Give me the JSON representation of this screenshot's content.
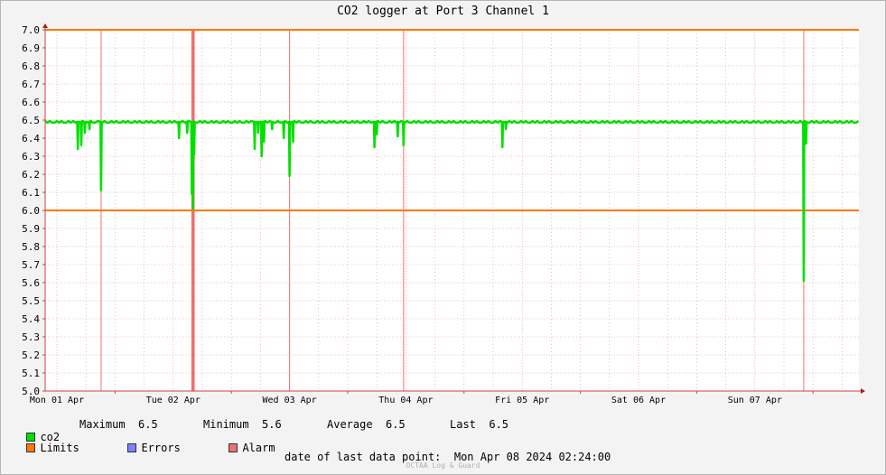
{
  "title": "CO2 logger at Port 3 Channel 1",
  "chart_data": {
    "type": "line",
    "title": "CO2 logger at Port 3 Channel 1",
    "ylim": [
      5.0,
      7.0
    ],
    "y_ticks": [
      "5.0",
      "5.1",
      "5.2",
      "5.3",
      "5.4",
      "5.5",
      "5.6",
      "5.7",
      "5.8",
      "5.9",
      "6.0",
      "6.1",
      "6.2",
      "6.3",
      "6.4",
      "6.5",
      "6.6",
      "6.7",
      "6.8",
      "6.9",
      "7.0"
    ],
    "x_ticks": [
      "Mon 01 Apr",
      "Tue 02 Apr",
      "Wed 03 Apr",
      "Thu 04 Apr",
      "Fri 05 Apr",
      "Sat 06 Apr",
      "Sun 07 Apr"
    ],
    "limits": [
      6.0,
      7.0
    ],
    "grid": true,
    "colors": {
      "co2": "#00e000",
      "limits": "#ff7700",
      "errors": "#7f7fff",
      "alarm": "#f07070",
      "grid": "#e09090"
    },
    "series": [
      {
        "name": "co2",
        "baseline": 6.49,
        "dips_day_value": [
          [
            0.18,
            6.34
          ],
          [
            0.21,
            6.36
          ],
          [
            0.24,
            6.43
          ],
          [
            0.28,
            6.45
          ],
          [
            0.38,
            6.11
          ],
          [
            1.05,
            6.4
          ],
          [
            1.12,
            6.43
          ],
          [
            1.16,
            6.09
          ],
          [
            1.17,
            6.01
          ],
          [
            1.18,
            6.31
          ],
          [
            1.7,
            6.34
          ],
          [
            1.73,
            6.43
          ],
          [
            1.76,
            6.3
          ],
          [
            1.78,
            6.38
          ],
          [
            1.85,
            6.45
          ],
          [
            1.95,
            6.4
          ],
          [
            2.0,
            6.19
          ],
          [
            2.03,
            6.38
          ],
          [
            2.73,
            6.35
          ],
          [
            2.75,
            6.42
          ],
          [
            2.93,
            6.41
          ],
          [
            2.98,
            6.36
          ],
          [
            3.83,
            6.35
          ],
          [
            3.86,
            6.45
          ],
          [
            6.42,
            5.61
          ],
          [
            6.44,
            6.37
          ]
        ]
      }
    ],
    "alarm_days": [
      0.38,
      1.16,
      2.0,
      2.98,
      6.42
    ],
    "alarm_bands": [
      [
        1.13,
        1.18
      ]
    ],
    "legend_entries": [
      "co2",
      "Limits",
      "Errors",
      "Alarm"
    ],
    "stats": {
      "maximum": "6.5",
      "minimum": "5.6",
      "average": "6.5",
      "last": "6.5"
    }
  },
  "legend": {
    "co2_label": "co2",
    "max_label": "Maximum",
    "max_value": "6.5",
    "min_label": "Minimum",
    "min_value": "5.6",
    "avg_label": "Average",
    "avg_value": "6.5",
    "last_label": "Last",
    "last_value": "6.5",
    "limits_label": "Limits",
    "errors_label": "Errors",
    "alarm_label": "Alarm"
  },
  "footer": {
    "date_label": "date of last data point:",
    "date_value": "Mon Apr 08 2024 02:24:00",
    "watermark": "OCTAA Log & Guard"
  }
}
